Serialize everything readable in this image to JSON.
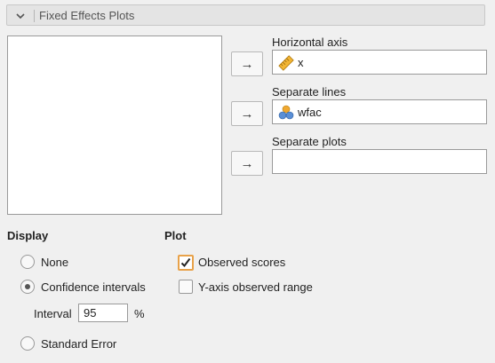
{
  "header": {
    "title": "Fixed Effects Plots",
    "chevron_icon": "chevron-down-icon"
  },
  "arrow_glyph": "→",
  "targets": {
    "horizontal_axis": {
      "label": "Horizontal axis",
      "variable": "x",
      "icon": "ruler-icon"
    },
    "separate_lines": {
      "label": "Separate lines",
      "variable": "wfac",
      "icon": "nominal-circles-icon"
    },
    "separate_plots": {
      "label": "Separate plots",
      "variable": ""
    }
  },
  "display": {
    "title": "Display",
    "options": [
      {
        "label": "None",
        "checked": false
      },
      {
        "label": "Confidence intervals",
        "checked": true
      },
      {
        "label": "Standard Error",
        "checked": false
      }
    ],
    "interval_label": "Interval",
    "interval_value": "95",
    "interval_unit": "%"
  },
  "plot": {
    "title": "Plot",
    "options": [
      {
        "label": "Observed scores",
        "checked": true
      },
      {
        "label": "Y-axis observed range",
        "checked": false
      }
    ]
  },
  "colors": {
    "checkbox_focus": "#e8a24a",
    "ruler_icon": "#f2b533",
    "nominal_icon_blue": "#5a8fd6",
    "nominal_icon_orange": "#f0a830"
  }
}
